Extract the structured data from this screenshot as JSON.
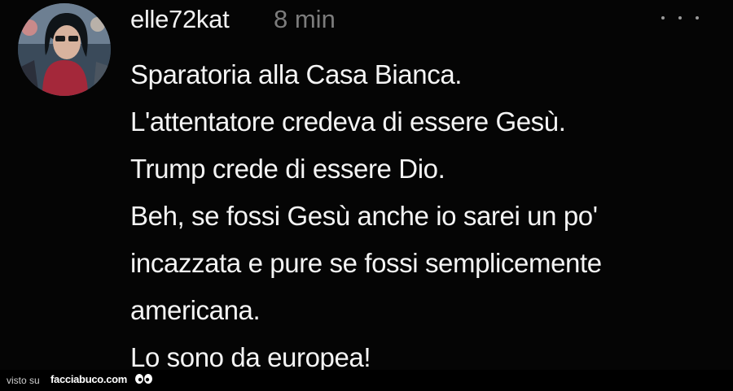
{
  "post": {
    "username": "elle72kat",
    "time": "8 min",
    "lines": [
      "Sparatoria alla Casa Bianca.",
      "L'attentatore credeva di essere Gesù.",
      "Trump crede di essere Dio.",
      "Beh, se fossi Gesù anche io sarei un po'",
      "incazzata e pure se fossi semplicemente",
      "americana.",
      "Lo sono da europea!"
    ],
    "more_icon": "ellipsis-icon"
  },
  "footer": {
    "visto_su": "visto su",
    "brand": "facciabuco.com",
    "logo_icon": "eyes-icon"
  },
  "colors": {
    "background": "#050505",
    "text": "#f4f4f4",
    "muted": "#7c7c7c"
  }
}
